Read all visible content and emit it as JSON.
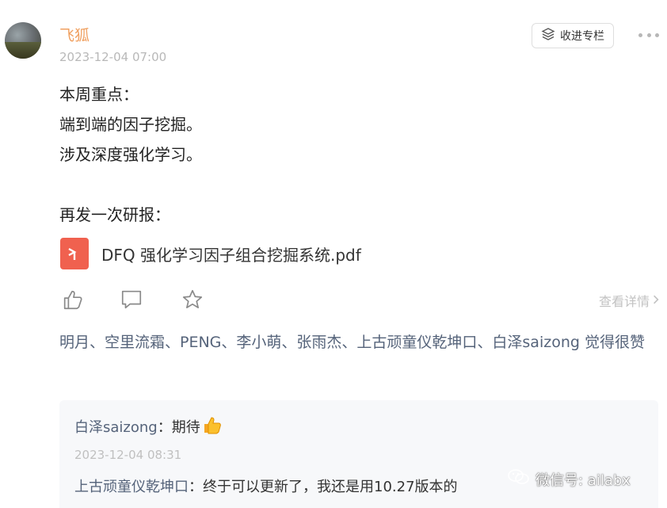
{
  "post": {
    "author": "飞狐",
    "time": "2023-12-04 07:00",
    "collect_label": "收进专栏",
    "content_lines": [
      "本周重点：",
      "端到端的因子挖掘。",
      "涉及深度强化学习。",
      "",
      "再发一次研报："
    ],
    "file_name": "DFQ 强化学习因子组合挖掘系统.pdf"
  },
  "actions": {
    "detail_label": "查看详情"
  },
  "likes": {
    "names": "明月、空里流霜、PENG、李小萌、张雨杰、上古顽童仪乾坤口、白泽saizong",
    "suffix": " 觉得很赞"
  },
  "comments": [
    {
      "name": "白泽saizong",
      "sep": "：",
      "text": "期待",
      "time": "2023-12-04 08:31"
    },
    {
      "name": "上古顽童仪乾坤口",
      "sep": "：",
      "text": "终于可以更新了，我还是用10.27版本的"
    }
  ],
  "watermark": {
    "text": "微信号: ailabx"
  },
  "colors": {
    "author": "#f0a060",
    "link": "#55637a",
    "pdf": "#f0614f"
  }
}
